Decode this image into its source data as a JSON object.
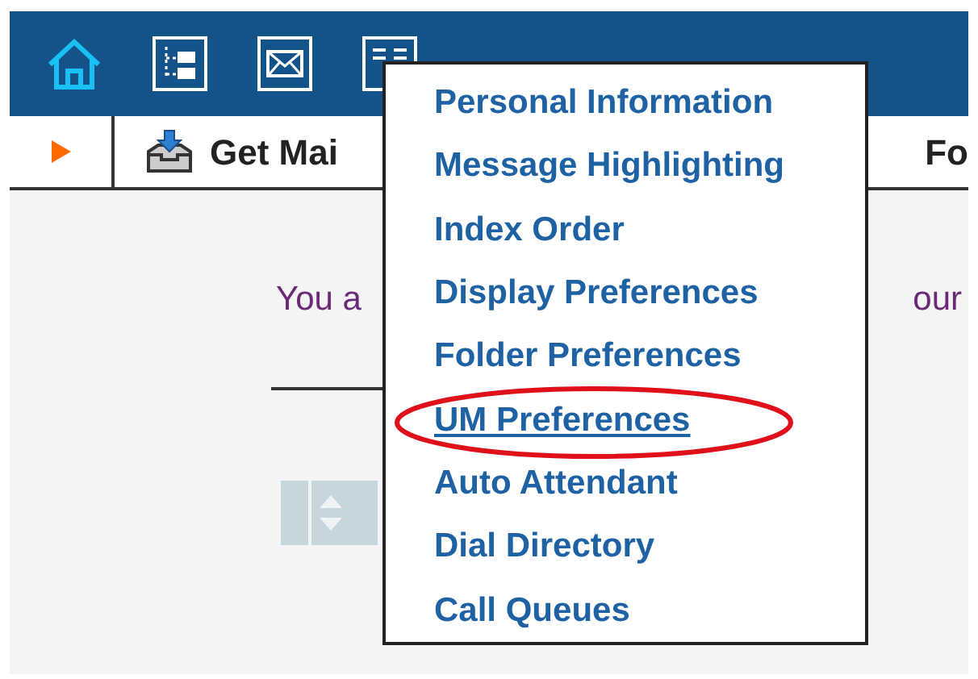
{
  "toolbar": {
    "get_mail": "Get Mai",
    "right_item": "Fo"
  },
  "content": {
    "text_left": "You a",
    "text_right": "our"
  },
  "menu": {
    "items": [
      {
        "label": "Personal Information",
        "selected": false
      },
      {
        "label": "Message Highlighting",
        "selected": false
      },
      {
        "label": "Index Order",
        "selected": false
      },
      {
        "label": "Display Preferences",
        "selected": false
      },
      {
        "label": "Folder Preferences",
        "selected": false
      },
      {
        "label": "UM Preferences",
        "selected": true
      },
      {
        "label": "Auto Attendant",
        "selected": false
      },
      {
        "label": "Dial Directory",
        "selected": false
      },
      {
        "label": "Call Queues",
        "selected": false
      }
    ]
  }
}
